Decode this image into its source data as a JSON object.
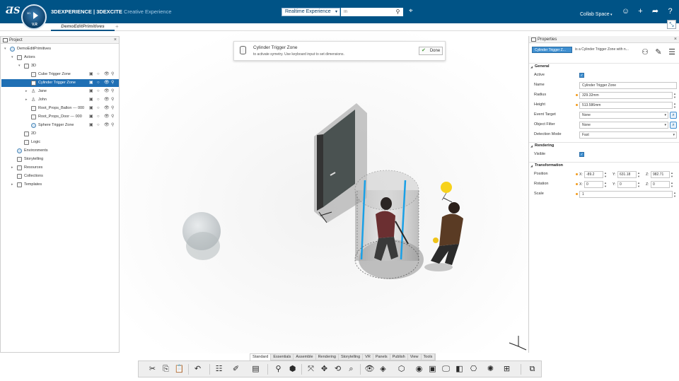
{
  "topbar": {
    "brand_main": "3DEXPERIENCE | 3DEXCITE",
    "brand_sub": "Creative Experience",
    "compass_label": "V.R",
    "compass_3d": "3D",
    "search_scope": "Realtime Experience",
    "search_placeholder": "In",
    "collab_space": "Collab Space"
  },
  "tabs": {
    "doc_tab": "DemoEditPrimitives",
    "add_tab": "+"
  },
  "project_panel": {
    "title": "Project",
    "tree": [
      {
        "label": "DemoEditPrimitives",
        "indent": 0,
        "twisty": "▾",
        "icon": "globe"
      },
      {
        "label": "Actors",
        "indent": 1,
        "twisty": "▾",
        "icon": "box"
      },
      {
        "label": "3D",
        "indent": 2,
        "twisty": "▾",
        "icon": "box"
      },
      {
        "label": "Cube Trigger Zone",
        "indent": 3,
        "twisty": "",
        "icon": "box",
        "controls": true
      },
      {
        "label": "Cylinder Trigger Zone",
        "indent": 3,
        "twisty": "",
        "icon": "box",
        "controls": true,
        "selected": true
      },
      {
        "label": "Jane",
        "indent": 3,
        "twisty": "▸",
        "icon": "person",
        "controls": true
      },
      {
        "label": "John",
        "indent": 3,
        "twisty": "▸",
        "icon": "person",
        "controls": true
      },
      {
        "label": "Root_Props_Ballon --- 000",
        "indent": 3,
        "twisty": "",
        "icon": "box",
        "controls": true
      },
      {
        "label": "Root_Props_Door --- 000",
        "indent": 3,
        "twisty": "",
        "icon": "box",
        "controls": true
      },
      {
        "label": "Sphere Trigger Zone",
        "indent": 3,
        "twisty": "",
        "icon": "globe",
        "controls": true
      },
      {
        "label": "2D",
        "indent": 2,
        "twisty": "",
        "icon": "box"
      },
      {
        "label": "Logic",
        "indent": 2,
        "twisty": "",
        "icon": "box"
      },
      {
        "label": "Environments",
        "indent": 1,
        "twisty": "",
        "icon": "globe"
      },
      {
        "label": "Storytelling",
        "indent": 1,
        "twisty": "",
        "icon": "box"
      },
      {
        "label": "Resources",
        "indent": 1,
        "twisty": "▸",
        "icon": "box"
      },
      {
        "label": "Collections",
        "indent": 1,
        "twisty": "",
        "icon": "box"
      },
      {
        "label": "Templates",
        "indent": 1,
        "twisty": "▸",
        "icon": "box"
      }
    ]
  },
  "hint": {
    "title": "Cylinder Trigger Zone",
    "text": "to activate symetry. Use keyboard input to set dimensions.",
    "done_label": "Done"
  },
  "properties_panel": {
    "title": "Properties",
    "object_chip": "Cylinder Trigger Z...",
    "object_desc": "is a Cylinder Trigger Zone with n...",
    "sections": {
      "general": "General",
      "rendering": "Rendering",
      "transformation": "Transformation"
    },
    "general": {
      "active_label": "Active",
      "name_label": "Name",
      "name_value": "Cylinder Trigger Zone",
      "radius_label": "Radius",
      "radius_value": "329.32mm",
      "height_label": "Height",
      "height_value": "513.586mm",
      "event_target_label": "Event Target",
      "event_target_value": "None",
      "object_filter_label": "Object Filter",
      "object_filter_value": "None",
      "detection_mode_label": "Detection Mode",
      "detection_mode_value": "Fast"
    },
    "rendering": {
      "visible_label": "Visible"
    },
    "transformation": {
      "position_label": "Position",
      "position": {
        "x": "-89.2",
        "y": "631.18",
        "z": "982.71"
      },
      "rotation_label": "Rotation",
      "rotation": {
        "x": "0",
        "y": "0",
        "z": "0"
      },
      "scale_label": "Scale",
      "scale_value": "1"
    }
  },
  "toolbar_tabs": [
    "Standard",
    "Essentials",
    "Assemble",
    "Rendering",
    "Storytelling",
    "VR",
    "Panels",
    "Publish",
    "View",
    "Tools"
  ],
  "toolbar_active_tab": "Standard",
  "colors": {
    "topbar": "#005386",
    "selection": "#1f6fb4",
    "accent": "#3f8fd0",
    "highlight": "#f29b1d"
  }
}
